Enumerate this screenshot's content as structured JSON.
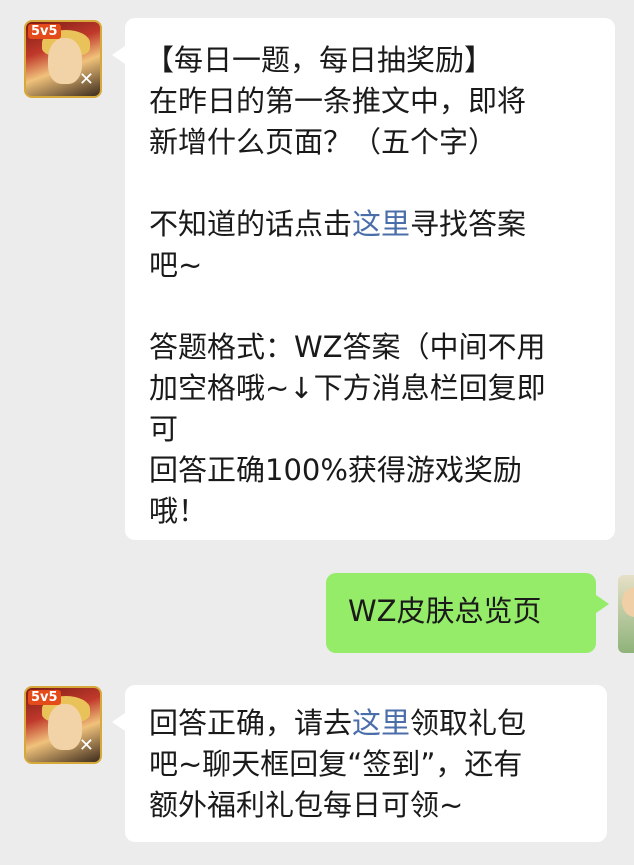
{
  "messages": {
    "first": {
      "lines": [
        "【每日一题，每日抽奖励】",
        "在昨日的第一条推文中，即将",
        "新增什么页面？（五个字）"
      ],
      "hint_before": "不知道的话点击",
      "hint_link": "这里",
      "hint_after": "寻找答案",
      "hint_line2": "吧~",
      "format_lines": [
        "答题格式：WZ答案（中间不用",
        "加空格哦~↓下方消息栏回复即",
        "可",
        "回答正确100%获得游戏奖励",
        "哦！"
      ]
    },
    "reply": {
      "text": "WZ皮肤总览页"
    },
    "second": {
      "before": "回答正确，请去",
      "link": "这里",
      "after": "领取礼包",
      "line2": "吧~聊天框回复“签到”，还有",
      "line3": "额外福利礼包每日可领~"
    }
  },
  "avatars": {
    "game_badge": "5v5"
  },
  "colors": {
    "background": "#ececec",
    "received_bubble": "#ffffff",
    "sent_bubble": "#95ec69",
    "link": "#4a6ea9"
  }
}
